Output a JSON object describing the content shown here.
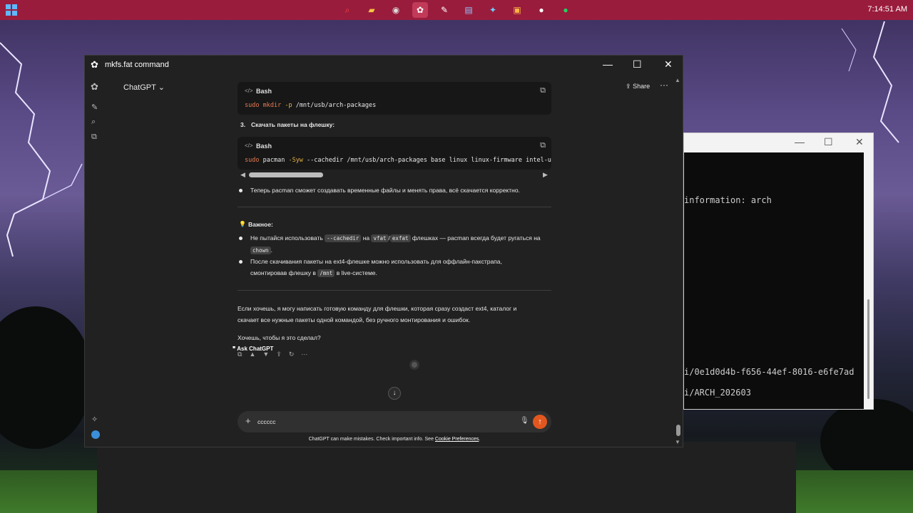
{
  "taskbar": {
    "clock": "7:14:51 AM",
    "icons": [
      "search-icon",
      "file-explorer-icon",
      "obs-icon",
      "chatgpt-icon",
      "pin-tool-icon",
      "notepad-icon",
      "paint-icon",
      "gallery-icon",
      "github-icon",
      "spotify-icon"
    ]
  },
  "window": {
    "title": "mkfs.fat command",
    "minimize": "—",
    "maximize": "☐",
    "close": "✕"
  },
  "header": {
    "model": "ChatGPT",
    "share": "Share",
    "more": "···"
  },
  "code_blocks": [
    {
      "lang": "Bash",
      "cmd": "sudo",
      "cmd2": "mkdir",
      "flag": "-p",
      "rest": " /mnt/usb/arch-packages"
    },
    {
      "lang": "Bash",
      "cmd": "sudo",
      "cmd2": "pacman",
      "flag": "-Syw",
      "rest": " --cachedir /mnt/usb/arch-packages base linux linux-firmware intel-uc"
    }
  ],
  "content": {
    "step3_num": "3.",
    "step3": "Скачать пакеты на флешку:",
    "bullet1": "Теперь pacman сможет создавать временные файлы и менять права, всё скачается корректно.",
    "important_icon": "💡",
    "important": "Важное:",
    "b2_pre": "Не пытайся использовать",
    "b2_code1": "--cachedir",
    "b2_mid1": "на",
    "b2_code2": "vfat",
    "b2_sep": "/",
    "b2_code3": "exfat",
    "b2_mid2": "флешках — pacman всегда будет ругаться на",
    "b2_code4": "chown",
    "b2_end": ".",
    "b3_line1": "После скачивания пакеты на ext4-флешке можно использовать для оффлайн-пакстрапа,",
    "b3_line2_pre": "смонтировав флешку в",
    "b3_code": "/mnt",
    "b3_line2_post": "в live-системе.",
    "para1_l1": "Если хочешь, я могу написать готовую команду для флешки, которая сразу создаст ext4, каталог и",
    "para1_l2": "скачает все нужные пакеты одной командой, без ручного монтирования и ошибок.",
    "para2": "Хочешь, чтобы я это сделал?",
    "ask": "Ask ChatGPT"
  },
  "composer": {
    "value": "cccccc",
    "placeholder": ""
  },
  "footer": {
    "text": "ChatGPT can make mistakes. Check important info. See",
    "link": "Cookie Preferences",
    "end": "."
  },
  "terminal": {
    "line1": "information: arch",
    "line2": "i/0e1d0d4b-f656-44ef-8016-e6fe7ad",
    "line3": "i/ARCH_202603"
  }
}
